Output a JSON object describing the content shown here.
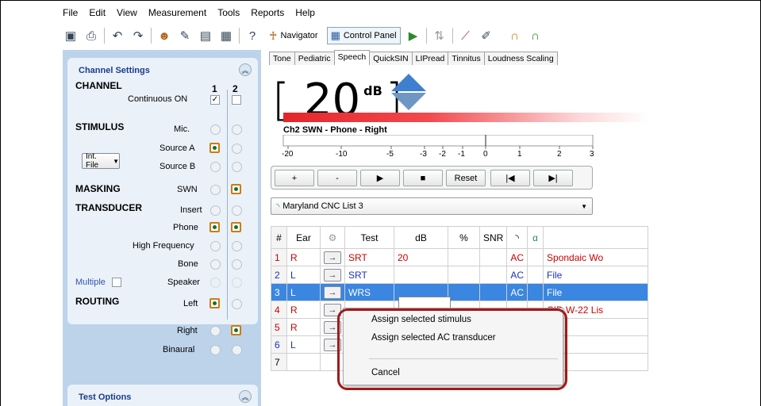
{
  "menu": [
    "File",
    "Edit",
    "View",
    "Measurement",
    "Tools",
    "Reports",
    "Help"
  ],
  "toolbar": {
    "navigator_label": "Navigator",
    "control_panel_label": "Control Panel"
  },
  "channel_settings": {
    "title": "Channel Settings",
    "ch1": "1",
    "ch2": "2",
    "channel_label": "CHANNEL",
    "continuous_on": "Continuous ON",
    "stimulus_label": "STIMULUS",
    "mic": "Mic.",
    "source_a": "Source A",
    "source_b": "Source B",
    "int_file": "Int. File",
    "masking_label": "MASKING",
    "swn": "SWN",
    "transducer_label": "TRANSDUCER",
    "insert": "Insert",
    "phone": "Phone",
    "high_frequency": "High Frequency",
    "bone": "Bone",
    "speaker": "Speaker",
    "multiple": "Multiple",
    "routing_label": "ROUTING",
    "left": "Left",
    "right": "Right",
    "binaural": "Binaural"
  },
  "test_options": {
    "title": "Test Options"
  },
  "tabs": [
    "Tone",
    "Pediatric",
    "Speech",
    "QuickSIN",
    "LIPread",
    "Tinnitus",
    "Loudness Scaling"
  ],
  "display": {
    "value": "20",
    "unit": "dB",
    "channel_line": "Ch2  SWN - Phone - Right"
  },
  "scale_ticks": [
    "-20",
    "-10",
    "-5",
    "-3",
    "-2",
    "-1",
    "0",
    "1",
    "2",
    "3"
  ],
  "controls": {
    "plus": "+",
    "minus": "-",
    "reset": "Reset"
  },
  "word_list": "Maryland CNC List 3",
  "table": {
    "headers": {
      "num": "#",
      "ear": "Ear",
      "test": "Test",
      "db": "dB",
      "pct": "%",
      "snr": "SNR"
    },
    "rows": [
      {
        "n": "1",
        "ear": "R",
        "test": "SRT",
        "db": "20",
        "type": "AC",
        "list": "Spondaic Wo"
      },
      {
        "n": "2",
        "ear": "L",
        "test": "SRT",
        "db": "",
        "type": "AC",
        "list": "File"
      },
      {
        "n": "3",
        "ear": "L",
        "test": "WRS",
        "db": "",
        "type": "AC",
        "list": "File"
      },
      {
        "n": "4",
        "ear": "R",
        "test": "",
        "db": "",
        "type": "",
        "list": "CID W-22 Lis"
      },
      {
        "n": "5",
        "ear": "R",
        "test": "",
        "db": "",
        "type": "",
        "list": "File"
      },
      {
        "n": "6",
        "ear": "L",
        "test": "",
        "db": "",
        "type": "",
        "list": "File"
      },
      {
        "n": "7",
        "ear": "",
        "test": "",
        "db": "",
        "type": "",
        "list": ""
      }
    ]
  },
  "context_menu": {
    "item1": "Assign selected stimulus",
    "item2": "Assign selected AC transducer",
    "cancel": "Cancel"
  },
  "colors": {
    "accent": "#3a86e0",
    "highlight": "#a11a1a",
    "panel": "#bcd3ea"
  }
}
